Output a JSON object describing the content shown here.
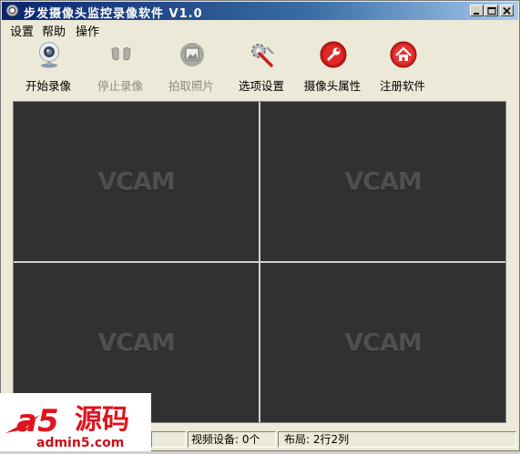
{
  "window": {
    "title": "步发摄像头监控录像软件 V1.0"
  },
  "menu": {
    "items": [
      "设置",
      "帮助",
      "操作"
    ]
  },
  "toolbar": {
    "buttons": [
      {
        "label": "开始录像",
        "icon": "webcam-icon",
        "enabled": true
      },
      {
        "label": "停止录像",
        "icon": "stop-record-icon",
        "enabled": false
      },
      {
        "label": "拍取照片",
        "icon": "photo-icon",
        "enabled": false
      },
      {
        "label": "选项设置",
        "icon": "settings-tools-icon",
        "enabled": true
      },
      {
        "label": "摄像头属性",
        "icon": "wrench-icon",
        "enabled": true
      },
      {
        "label": "注册软件",
        "icon": "home-icon",
        "enabled": true
      }
    ]
  },
  "video": {
    "watermark": "VCAM",
    "rows": 2,
    "cols": 2
  },
  "status": {
    "devices": "视频设备: 0个",
    "layout": "布局: 2行2列"
  },
  "logo": {
    "mark": "a5",
    "name": "源码",
    "url": "admin5.com"
  },
  "colors": {
    "titlebar": "#0a246a",
    "video_bg": "#313131",
    "logo_red": "#e0141e"
  }
}
